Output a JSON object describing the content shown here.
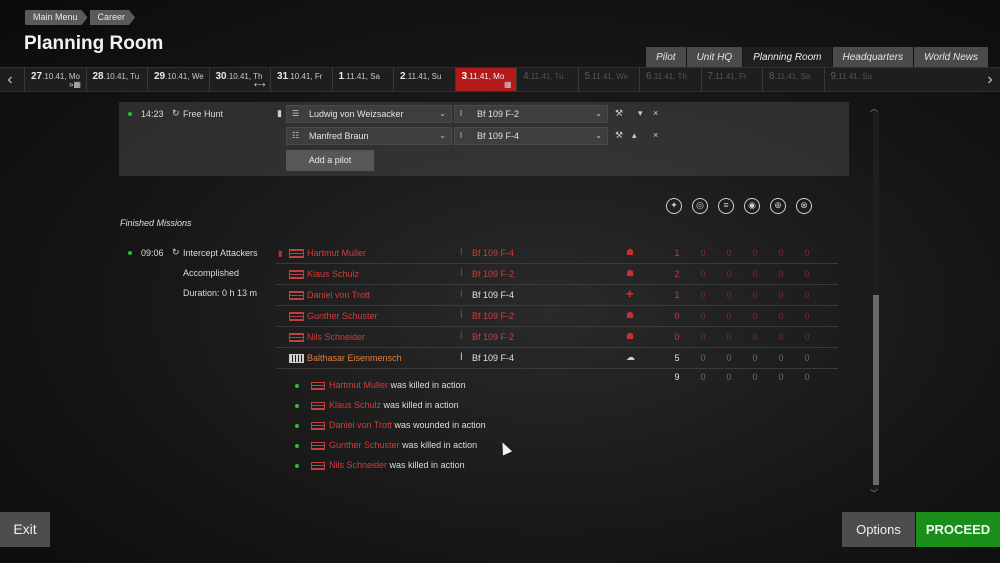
{
  "breadcrumb": [
    "Main Menu",
    "Career"
  ],
  "page_title": "Planning Room",
  "tabs": [
    {
      "label": "Pilot",
      "active": false
    },
    {
      "label": "Unit HQ",
      "active": false
    },
    {
      "label": "Planning Room",
      "active": true
    },
    {
      "label": "Headquarters",
      "active": false
    },
    {
      "label": "World News",
      "active": false
    }
  ],
  "datebar": {
    "days": [
      {
        "num": "27",
        "rest": ".10.41, Mo",
        "state": "past"
      },
      {
        "num": "28",
        "rest": ".10.41, Tu",
        "state": "past"
      },
      {
        "num": "29",
        "rest": ".10.41, We",
        "state": "past"
      },
      {
        "num": "30",
        "rest": ".10.41, Th",
        "state": "past"
      },
      {
        "num": "31",
        "rest": ".10.41, Fr",
        "state": "past"
      },
      {
        "num": "1",
        "rest": ".11.41, Sa",
        "state": "past"
      },
      {
        "num": "2",
        "rest": ".11.41, Su",
        "state": "past"
      },
      {
        "num": "3",
        "rest": ".11.41, Mo",
        "state": "current"
      },
      {
        "num": "4",
        "rest": ".11.41, Tu",
        "state": "future"
      },
      {
        "num": "5",
        "rest": ".11.41, We",
        "state": "future"
      },
      {
        "num": "6",
        "rest": ".11.41, Th",
        "state": "future"
      },
      {
        "num": "7",
        "rest": ".11.41, Fr",
        "state": "future"
      },
      {
        "num": "8",
        "rest": ".11.41, Sa",
        "state": "future"
      },
      {
        "num": "9",
        "rest": ".11.41, Su",
        "state": "future"
      }
    ]
  },
  "active_mission": {
    "time": "14:23",
    "type": "Free Hunt",
    "pilots": [
      {
        "name": "Ludwig von Weizsacker",
        "plane": "Bf 109 F-2"
      },
      {
        "name": "Manfred Braun",
        "plane": "Bf 109 F-4"
      }
    ],
    "add_pilot_label": "Add a pilot"
  },
  "finished": {
    "section_title": "Finished Missions",
    "mission": {
      "time": "09:06",
      "type": "Intercept Attackers",
      "result": "Accomplished",
      "duration": "Duration: 0 h 13 m"
    },
    "rows": [
      {
        "name": "Hartmut Muller",
        "plane": "Bf 109 F-4",
        "color": "red",
        "stats": [
          "1",
          "0",
          "0",
          "0",
          "0",
          "0"
        ]
      },
      {
        "name": "Klaus Schulz",
        "plane": "Bf 109 F-2",
        "color": "red",
        "stats": [
          "2",
          "0",
          "0",
          "0",
          "0",
          "0"
        ]
      },
      {
        "name": "Daniel von Trott",
        "plane": "Bf 109 F-4",
        "color": "red",
        "stats": [
          "1",
          "0",
          "0",
          "0",
          "0",
          "0"
        ]
      },
      {
        "name": "Gunther Schuster",
        "plane": "Bf 109 F-2",
        "color": "red",
        "stats": [
          "0",
          "0",
          "0",
          "0",
          "0",
          "0"
        ]
      },
      {
        "name": "Nils Schneider",
        "plane": "Bf 109 F-2",
        "color": "red",
        "stats": [
          "0",
          "0",
          "0",
          "0",
          "0",
          "0"
        ]
      },
      {
        "name": "Balthasar Eisenmensch",
        "plane": "Bf 109 F-4",
        "color": "orange",
        "stats": [
          "5",
          "0",
          "0",
          "0",
          "0",
          "0"
        ]
      }
    ],
    "totals": [
      "9",
      "0",
      "0",
      "0",
      "0",
      "0"
    ],
    "events": [
      {
        "name": "Hartmut Muller",
        "text": "was killed in action"
      },
      {
        "name": "Klaus Schulz",
        "text": "was killed in action"
      },
      {
        "name": "Daniel von Trott",
        "text": "was wounded in action"
      },
      {
        "name": "Gunther Schuster",
        "text": "was killed in action"
      },
      {
        "name": "Nils Schneider",
        "text": "was killed in action"
      }
    ]
  },
  "buttons": {
    "exit": "Exit",
    "options": "Options",
    "proceed": "PROCEED"
  },
  "colors": {
    "accent_red": "#b31a1a",
    "proceed_green": "#1a8f1a"
  }
}
